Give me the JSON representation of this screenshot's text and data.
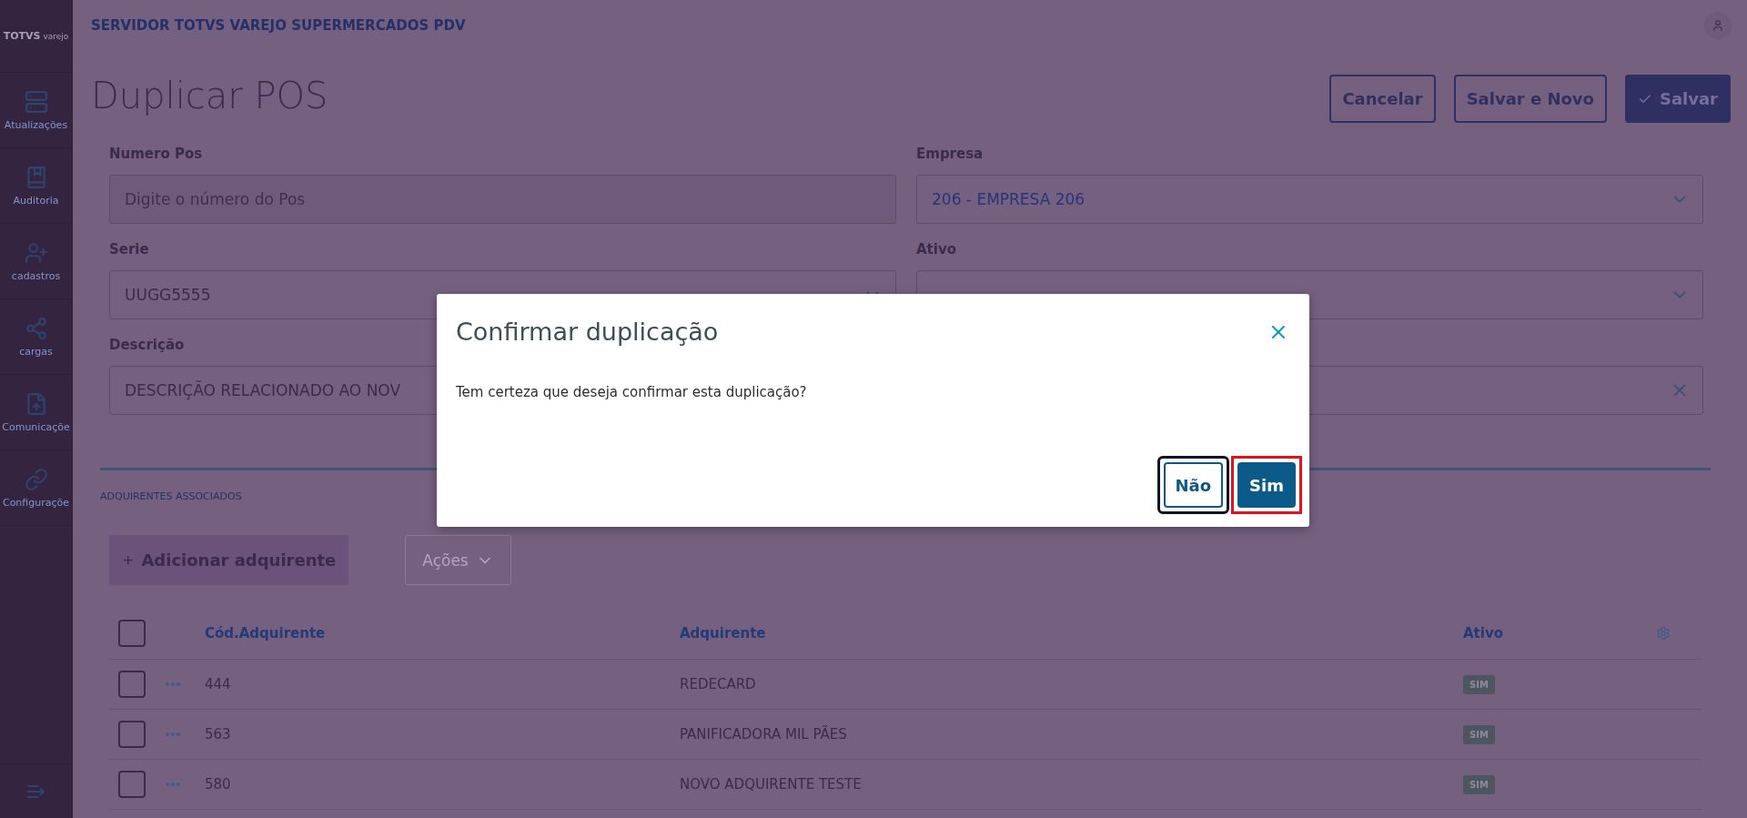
{
  "sidebar": {
    "logo": "TOTVS",
    "logo_sub": "varejo",
    "items": [
      {
        "label": "Atualizações",
        "selected": false
      },
      {
        "label": "Auditoria",
        "selected": false
      },
      {
        "label": "cadastros",
        "selected": false
      },
      {
        "label": "cargas",
        "selected": false
      },
      {
        "label": "Comunicaçõe",
        "selected": false
      },
      {
        "label": "Configuraçõe",
        "selected": false
      }
    ]
  },
  "header": {
    "app_title": "SERVIDOR TOTVS VAREJO SUPERMERCADOS PDV"
  },
  "page": {
    "title": "Duplicar POS",
    "actions": [
      {
        "label": "Cancelar",
        "kind": "outline"
      },
      {
        "label": "Salvar e Novo",
        "kind": "outline"
      },
      {
        "label": "Salvar",
        "kind": "primary"
      }
    ]
  },
  "form": {
    "fields": [
      {
        "label": "Numero Pos",
        "kind": "text",
        "placeholder": "Digite o número do Pos"
      },
      {
        "label": "Empresa",
        "kind": "select",
        "value": "206 - EMPRESA 206"
      },
      {
        "label": "Serie",
        "kind": "select",
        "value": "UUGG5555"
      },
      {
        "label": "Ativo",
        "kind": "select"
      },
      {
        "label": "Descrição",
        "kind": "text",
        "value": "DESCRIÇÃO RELACIONADO AO NOV"
      },
      {
        "kind": "clear"
      }
    ]
  },
  "section": {
    "title": "ADQUIRENTES ASSOCIADOS",
    "add_button": "Adicionar adquirente",
    "add_icon": "+",
    "actions_button": {
      "label": "Ações",
      "disabled": true
    }
  },
  "table": {
    "columns": [
      "Cód.Adquirente",
      "Adquirente",
      "Ativo"
    ],
    "all_checked": false,
    "rows": [
      {
        "checked": false,
        "code": "444",
        "name": "REDECARD",
        "active": "SIM"
      },
      {
        "checked": false,
        "code": "563",
        "name": "PANIFICADORA MIL PÃES",
        "active": "SIM"
      },
      {
        "checked": false,
        "code": "580",
        "name": "NOVO ADQUIRENTE TESTE",
        "active": "SIM"
      }
    ]
  },
  "dialog": {
    "title": "Confirmar duplicação",
    "message": "Tem certeza que deseja confirmar esta duplicação?",
    "buttons": [
      {
        "label": "Não",
        "kind": "secondary",
        "focused": true
      },
      {
        "label": "Sim",
        "kind": "primary",
        "highlighted": true
      }
    ]
  }
}
